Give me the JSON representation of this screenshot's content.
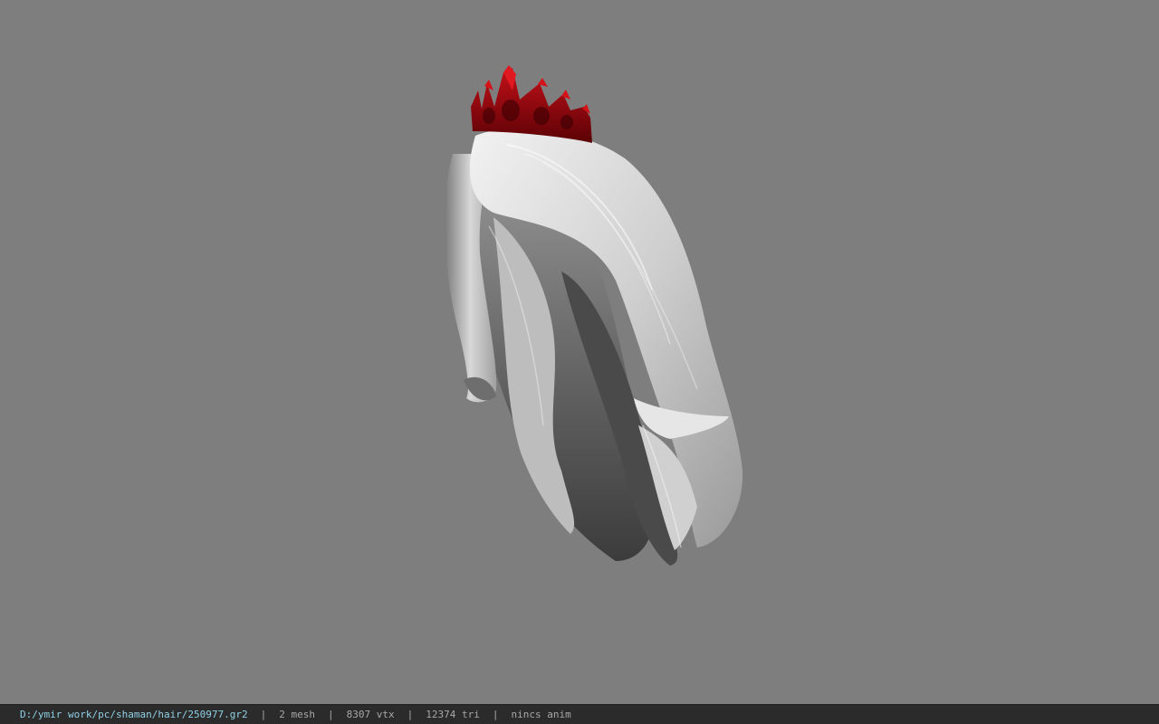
{
  "viewer": {
    "background_color": "#7e7e7e",
    "model": {
      "subject": "long white hair with red crown",
      "hair_color": "#d9d9d9",
      "crown_color": "#9b0a10"
    }
  },
  "status_bar": {
    "file_path": "D:/ymir work/pc/shaman/hair/250977.gr2",
    "separator": "|",
    "mesh_count": "2 mesh",
    "vertex_count": "8307 vtx",
    "triangle_count": "12374 tri",
    "animation": "nincs anim",
    "background_color": "#2b2b2b",
    "path_color": "#8ed0e6"
  }
}
